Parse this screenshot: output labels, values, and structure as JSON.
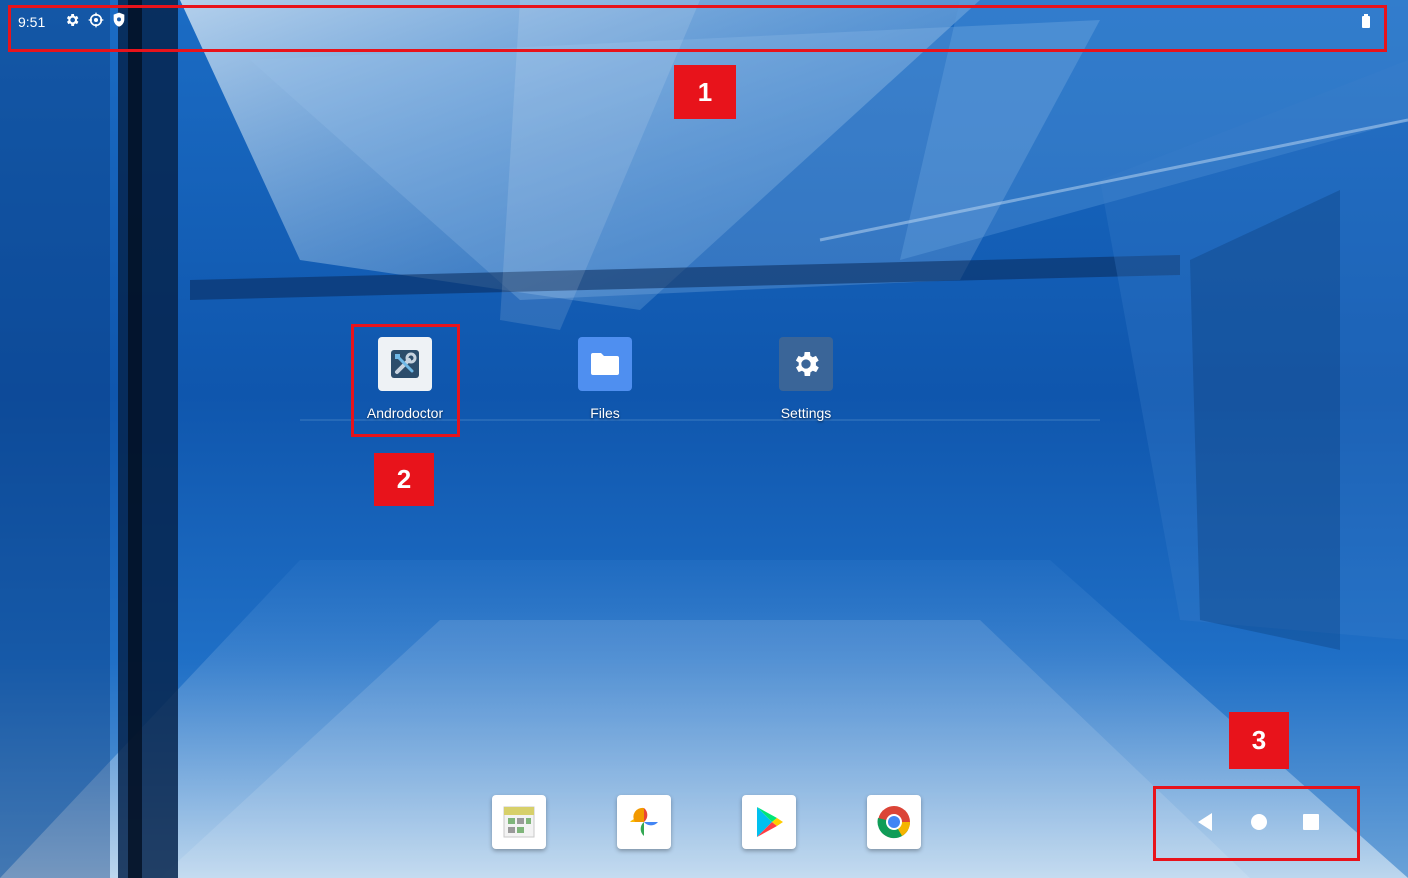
{
  "status_bar": {
    "time": "9:51",
    "icons": [
      "settings-gear-icon",
      "sync-gear-icon",
      "shield-icon"
    ],
    "battery_icon": "battery-icon"
  },
  "annotations": [
    "1",
    "2",
    "3"
  ],
  "home_apps": [
    {
      "label": "Androdoctor",
      "icon": "androdoctor-tools-icon"
    },
    {
      "label": "Files",
      "icon": "folder-icon"
    },
    {
      "label": "Settings",
      "icon": "settings-gear-icon"
    }
  ],
  "dock": [
    {
      "icon": "calendar-app-icon"
    },
    {
      "icon": "google-photos-icon"
    },
    {
      "icon": "play-store-icon"
    },
    {
      "icon": "chrome-icon"
    }
  ],
  "nav_bar": [
    "back-icon",
    "home-icon",
    "recents-icon"
  ],
  "colors": {
    "annotation_red": "#e8131b",
    "wallpaper_blue": "#0b4a9a"
  }
}
